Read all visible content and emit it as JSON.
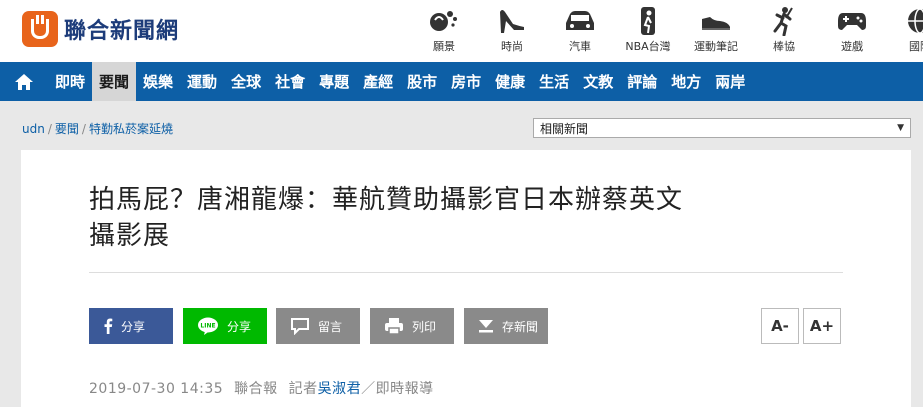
{
  "header": {
    "logo_text": "聯合新聞網",
    "channels": [
      {
        "label": "願景",
        "icon": "vision-icon"
      },
      {
        "label": "時尚",
        "icon": "high-heel-icon"
      },
      {
        "label": "汽車",
        "icon": "car-icon"
      },
      {
        "label": "NBA台灣",
        "icon": "nba-icon"
      },
      {
        "label": "運動筆記",
        "icon": "sneaker-icon"
      },
      {
        "label": "棒協",
        "icon": "baseball-player-icon"
      },
      {
        "label": "遊戲",
        "icon": "gamepad-icon"
      },
      {
        "label": "國際",
        "icon": "globe-icon"
      }
    ]
  },
  "nav": {
    "items": [
      "即時",
      "要聞",
      "娛樂",
      "運動",
      "全球",
      "社會",
      "專題",
      "產經",
      "股市",
      "房市",
      "健康",
      "生活",
      "文教",
      "評論",
      "地方",
      "兩岸"
    ],
    "active": "要聞"
  },
  "breadcrumb": {
    "items": [
      "udn",
      "要聞",
      "特勤私菸案延燒"
    ]
  },
  "related_select": {
    "value": "相關新聞"
  },
  "article": {
    "title_line1": "拍馬屁？唐湘龍爆：華航贊助攝影官日本辦蔡英文",
    "title_line2": "攝影展",
    "buttons": {
      "facebook": "分享",
      "line": "分享",
      "comment": "留言",
      "print": "列印",
      "save": "存新聞"
    },
    "font_minus": "A-",
    "font_plus": "A+",
    "meta": {
      "datetime": "2019-07-30 14:35",
      "source": "聯合報",
      "reporter_prefix": "記者",
      "reporter": "吳淑君",
      "suffix": "／即時報導"
    }
  },
  "colors": {
    "nav_bg": "#0d5fa6",
    "logo_orange": "#e8641b",
    "facebook": "#3b5998",
    "line": "#00b900"
  }
}
